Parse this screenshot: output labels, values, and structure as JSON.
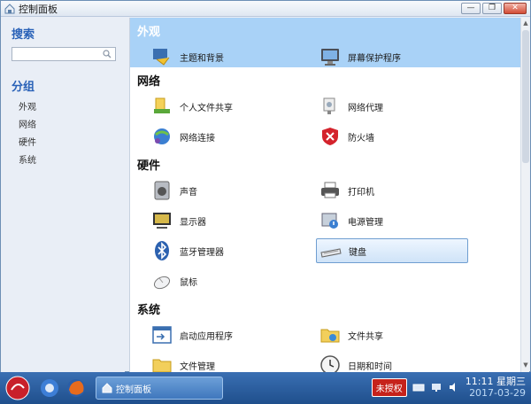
{
  "window": {
    "title": "控制面板",
    "controls": [
      "—",
      "❐",
      "✕"
    ]
  },
  "sidebar": {
    "search_heading": "搜索",
    "search_placeholder": "",
    "group_heading": "分组",
    "groups": [
      "外观",
      "网络",
      "硬件",
      "系统"
    ]
  },
  "main": {
    "categories": [
      {
        "title": "外观",
        "items": [
          {
            "label": "主题和背景",
            "icon": "theme-icon"
          },
          {
            "label": "屏幕保护程序",
            "icon": "screensaver-icon"
          }
        ]
      },
      {
        "title": "网络",
        "items": [
          {
            "label": "个人文件共享",
            "icon": "personal-share-icon"
          },
          {
            "label": "网络代理",
            "icon": "proxy-icon"
          },
          {
            "label": "网络连接",
            "icon": "network-connection-icon"
          },
          {
            "label": "防火墙",
            "icon": "firewall-icon"
          }
        ]
      },
      {
        "title": "硬件",
        "items": [
          {
            "label": "声音",
            "icon": "speaker-icon"
          },
          {
            "label": "打印机",
            "icon": "printer-icon"
          },
          {
            "label": "显示器",
            "icon": "monitor-icon"
          },
          {
            "label": "电源管理",
            "icon": "power-icon"
          },
          {
            "label": "蓝牙管理器",
            "icon": "bluetooth-icon"
          },
          {
            "label": "键盘",
            "icon": "keyboard-icon"
          },
          {
            "label": "鼠标",
            "icon": "mouse-icon"
          }
        ]
      },
      {
        "title": "系统",
        "items": [
          {
            "label": "启动应用程序",
            "icon": "startup-apps-icon"
          },
          {
            "label": "文件共享",
            "icon": "file-share-icon"
          },
          {
            "label": "文件管理",
            "icon": "folder-icon"
          },
          {
            "label": "日期和时间",
            "icon": "clock-icon"
          }
        ]
      }
    ]
  },
  "taskbar": {
    "task_label": "控制面板",
    "badge": "未授权",
    "time": "11:11 星期三",
    "date": "2017-03-29"
  },
  "colors": {
    "accent": "#2a62b8",
    "highlight": "#a9d2f7",
    "taskbar": "#2a5f9f"
  }
}
